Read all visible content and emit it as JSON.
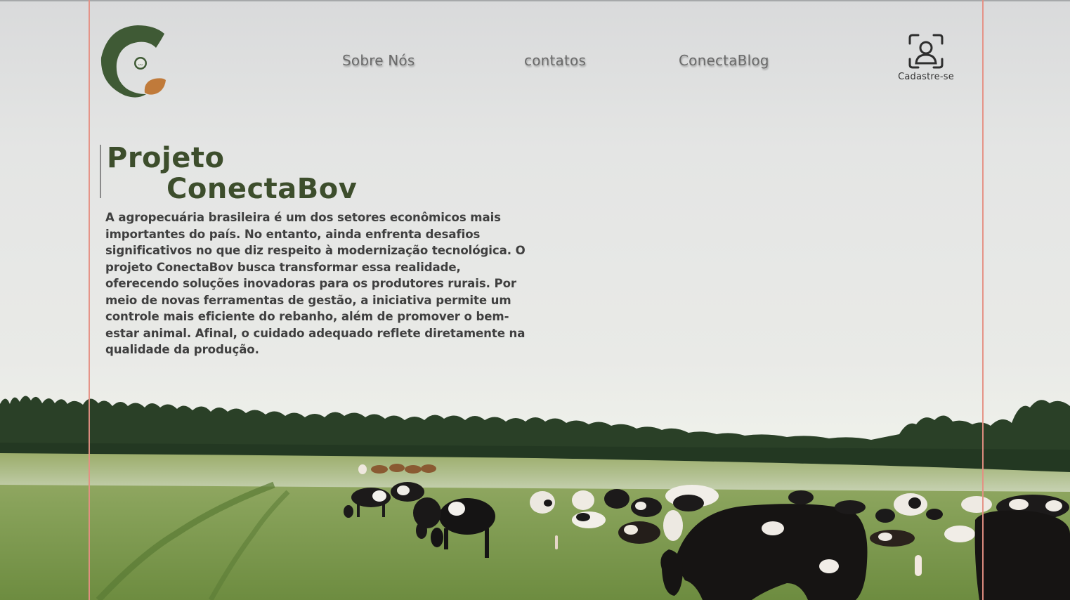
{
  "header": {
    "logo_name": "conectabov-logo",
    "nav": [
      {
        "label": "Sobre Nós"
      },
      {
        "label": "contatos"
      },
      {
        "label": "ConectaBlog"
      }
    ],
    "signup": {
      "label": "Cadastre-se",
      "icon": "user-scan-icon"
    }
  },
  "hero": {
    "title_line1": "Projeto",
    "title_line2": "ConectaBov",
    "paragraph": " A agropecuária brasileira é um dos setores econômicos mais\nimportantes do país. No entanto, ainda enfrenta desafios\nsignificativos no que diz respeito à modernização tecnológica. O\nprojeto ConectaBov busca transformar essa realidade,\noferecendo soluções inovadoras para os produtores rurais. Por\nmeio de novas ferramentas de gestão, a iniciativa permite um\ncontrole mais eficiente do rebanho, além de promover o bem-\nestar animal. Afinal, o cuidado adequado reflete diretamente na\nqualidade da produção."
  },
  "colors": {
    "title_green": "#3d4e2c",
    "logo_green": "#3f5a35",
    "logo_orange": "#c07a3a",
    "guide_line": "#e58f83",
    "grass": "#7f9a52",
    "tree_line": "#223a22"
  }
}
